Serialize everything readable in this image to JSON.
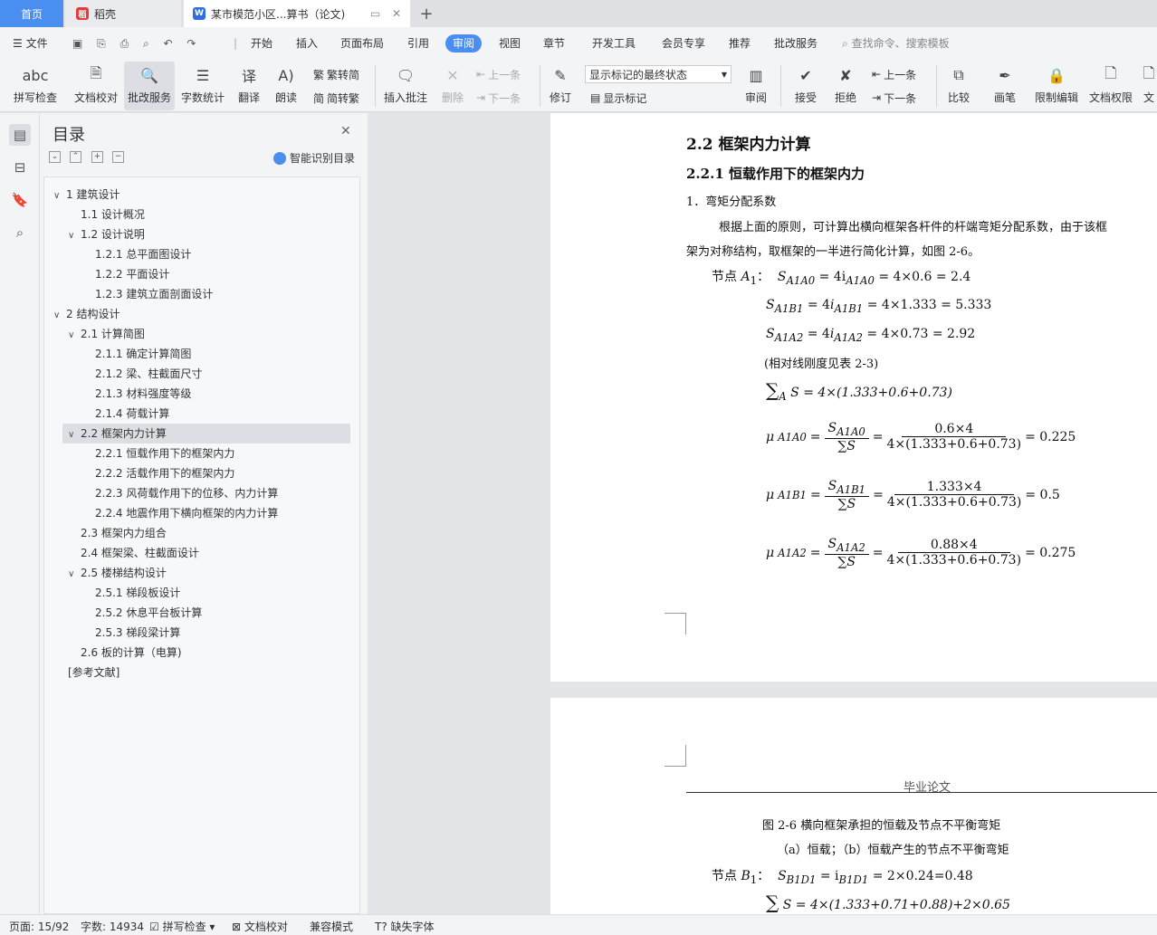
{
  "tabs": {
    "home": "首页",
    "daoke": "稻壳",
    "doc": "某市模范小区...算书（论文)",
    "plus": "+"
  },
  "menu": {
    "file": "文件",
    "items": [
      "开始",
      "插入",
      "页面布局",
      "引用",
      "审阅",
      "视图",
      "章节",
      "开发工具",
      "会员专享",
      "推荐",
      "批改服务"
    ],
    "search_placeholder": "查找命令、搜索模板"
  },
  "ribbon": {
    "spellcheck": "拼写检查",
    "doc_proof": "文档校对",
    "review_service": "批改服务",
    "word_count": "字数统计",
    "translate": "翻译",
    "read_aloud": "朗读",
    "trad": "繁转简",
    "simp": "简转繁",
    "insert_comment": "插入批注",
    "delete": "删除",
    "prev": "上一条",
    "next": "下一条",
    "track": "修订",
    "show_state": "显示标记的最终状态",
    "show_marks": "显示标记",
    "review": "审阅",
    "accept": "接受",
    "reject": "拒绝",
    "prev2": "上一条",
    "next2": "下一条",
    "compare": "比较",
    "pen": "画笔",
    "restrict": "限制编辑",
    "doc_perm": "文档权限",
    "doc_more": "文"
  },
  "toc": {
    "title": "目录",
    "smart": "智能识别目录",
    "items": [
      {
        "text": "1  建筑设计",
        "level": 1,
        "chev": "v"
      },
      {
        "text": "1.1  设计概况",
        "level": 2,
        "chev": ""
      },
      {
        "text": "1.2  设计说明",
        "level": 2,
        "chev": "v"
      },
      {
        "text": "1.2.1  总平面图设计",
        "level": 3,
        "chev": ""
      },
      {
        "text": "1.2.2  平面设计",
        "level": 3,
        "chev": ""
      },
      {
        "text": "1.2.3 建筑立面剖面设计",
        "level": 3,
        "chev": ""
      },
      {
        "text": "2  结构设计",
        "level": 1,
        "chev": "v"
      },
      {
        "text": "2.1  计算简图",
        "level": 2,
        "chev": "v"
      },
      {
        "text": "2.1.1  确定计算简图",
        "level": 3,
        "chev": ""
      },
      {
        "text": "2.1.2  梁、柱截面尺寸",
        "level": 3,
        "chev": ""
      },
      {
        "text": "2.1.3  材料强度等级",
        "level": 3,
        "chev": ""
      },
      {
        "text": "2.1.4  荷载计算",
        "level": 3,
        "chev": ""
      },
      {
        "text": "2.2  框架内力计算",
        "level": 2,
        "chev": "v"
      },
      {
        "text": "2.2.1  恒载作用下的框架内力",
        "level": 3,
        "chev": ""
      },
      {
        "text": "2.2.2  活载作用下的框架内力",
        "level": 3,
        "chev": ""
      },
      {
        "text": "2.2.3  风荷载作用下的位移、内力计算",
        "level": 3,
        "chev": ""
      },
      {
        "text": "2.2.4 地震作用下横向框架的内力计算",
        "level": 3,
        "chev": ""
      },
      {
        "text": "2.3  框架内力组合",
        "level": 2,
        "chev": ""
      },
      {
        "text": "2.4  框架梁、柱截面设计",
        "level": 2,
        "chev": ""
      },
      {
        "text": "2.5 楼梯结构设计",
        "level": 2,
        "chev": "v"
      },
      {
        "text": "2.5.1  梯段板设计",
        "level": 3,
        "chev": ""
      },
      {
        "text": "2.5.2  休息平台板计算",
        "level": 3,
        "chev": ""
      },
      {
        "text": "2.5.3  梯段梁计算",
        "level": 3,
        "chev": ""
      },
      {
        "text": "2.6 板的计算（电算)",
        "level": 2,
        "chev": ""
      },
      {
        "text": "[参考文献]",
        "level": 0,
        "chev": ""
      }
    ]
  },
  "doc": {
    "h2": "2.2  框架内力计算",
    "h3": "2.2.1  恒载作用下的框架内力",
    "item1": "1．弯矩分配系数",
    "para1": "根据上面的原则，可计算出横向框架各杆件的杆端弯矩分配系数，由于该框",
    "para2": "架为对称结构，取框架的一半进行简化计算，如图 2-6。",
    "nodeA": "节点",
    "eq1": "= 4i",
    "eq1r": "= 4×0.6 = 2.4",
    "eq2r": "= 4×1.333 = 5.333",
    "eq3r": "= 4×0.73 = 2.92",
    "note": "(相对线刚度见表 2-3)",
    "sum": "S = 4×(1.333+0.6+0.73)",
    "mu1_num": "0.6×4",
    "mu1_res": "= 0.225",
    "mu2_num": "1.333×4",
    "mu2_res": "= 0.5",
    "mu3_num": "0.88×4",
    "mu3_res": "= 0.275",
    "den": "4×(1.333+0.6+0.73)",
    "header": "毕业论文",
    "fig": "图 2-6     横向框架承担的恒载及节点不平衡弯矩",
    "figsub": "（a）恒载；（b）恒载产生的节点不平衡弯矩",
    "nodeB": "节点",
    "eqB": "= i",
    "eqBr": "= 2×0.24=0.48",
    "sumB": "S = 4×(1.333+0.71+0.88)+2×0.65"
  },
  "status": {
    "page": "页面: 15/92",
    "words": "字数: 14934",
    "spell": "拼写检查",
    "proof": "文档校对",
    "compat": "兼容模式",
    "font": "缺失字体"
  }
}
